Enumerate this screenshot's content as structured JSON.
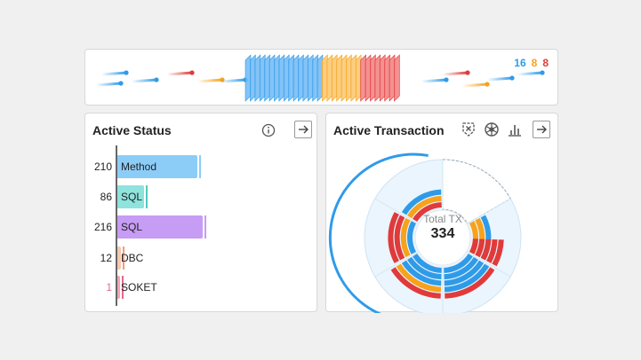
{
  "traffic": {
    "counts": {
      "blue": "16",
      "orange": "8",
      "red": "8"
    },
    "colors": {
      "blue": "#2f9be8",
      "orange": "#f7a21b",
      "red": "#e03a3a"
    }
  },
  "active_status": {
    "title": "Active Status",
    "info_icon": "info-icon",
    "go_icon": "arrow-right-icon",
    "rows": [
      {
        "value": "210",
        "label": "Method",
        "color": "#8ccdf8",
        "tick": "#8ccdf8",
        "fraction": 0.45
      },
      {
        "value": "86",
        "label": "SQL",
        "color": "#8ee3dd",
        "tick": "#4fc9c1",
        "fraction": 0.15
      },
      {
        "value": "216",
        "label": "SQL",
        "color": "#c79cf5",
        "tick": "#c79cf5",
        "fraction": 0.48
      },
      {
        "value": "12",
        "label": "DBC",
        "color": "#f7c9b0",
        "tick": "#f29c7c",
        "fraction": 0.02
      },
      {
        "value": "1",
        "label": "SOKET",
        "color": "#f4a3b8",
        "tick": "#e36b89",
        "fraction": 0.0
      }
    ]
  },
  "active_transaction": {
    "title": "Active Transaction",
    "icons": [
      "close-shield-icon",
      "wheel-icon",
      "bar-chart-icon",
      "arrow-right-icon"
    ],
    "center_label": "Total TX",
    "center_value": "334",
    "colors": {
      "blue": "#2f9be8",
      "orange": "#f7a21b",
      "red": "#e03a3a"
    }
  }
}
